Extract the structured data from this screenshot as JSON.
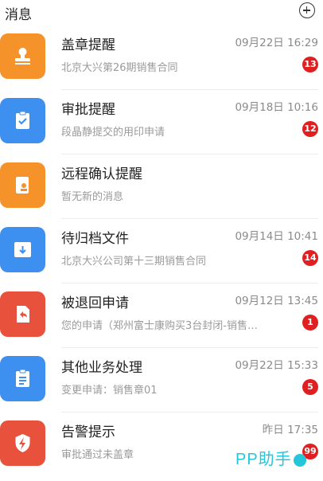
{
  "header": {
    "title": "消息"
  },
  "items": [
    {
      "name": "盖章提醒",
      "time": "09月22日 16:29",
      "sub": "北京大兴第26期销售合同",
      "badge": "13",
      "icon": "stamp-icon",
      "color": "#f5922a"
    },
    {
      "name": "审批提醒",
      "time": "09月18日 10:16",
      "sub": "段晶静提交的用印申请",
      "badge": "12",
      "icon": "clipboard-check-icon",
      "color": "#3d8ff0"
    },
    {
      "name": "远程确认提醒",
      "time": "",
      "sub": "暂无新的消息",
      "badge": "",
      "icon": "remote-stamp-icon",
      "color": "#f5922a"
    },
    {
      "name": "待归档文件",
      "time": "09月14日 10:41",
      "sub": "北京大兴公司第十三期销售合同",
      "badge": "14",
      "icon": "archive-icon",
      "color": "#3d8ff0"
    },
    {
      "name": "被退回申请",
      "time": "09月12日 13:45",
      "sub": "您的申请（郑州富士康购买3台封闭-销售…",
      "badge": "1",
      "icon": "return-icon",
      "color": "#e8523d"
    },
    {
      "name": "其他业务处理",
      "time": "09月22日 15:33",
      "sub": "变更申请：销售章01",
      "badge": "5",
      "icon": "document-list-icon",
      "color": "#3d8ff0"
    },
    {
      "name": "告警提示",
      "time": "昨日 17:35",
      "sub": "审批通过未盖章",
      "badge": "99",
      "icon": "alert-bolt-icon",
      "color": "#e8523d"
    }
  ],
  "watermark": {
    "text": "PP助手"
  }
}
